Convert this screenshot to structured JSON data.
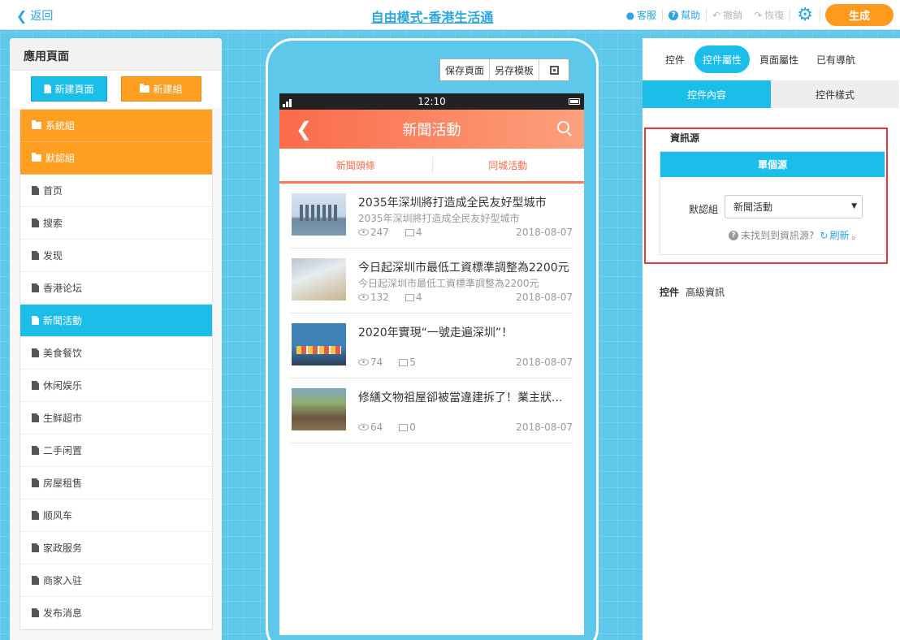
{
  "topbar": {
    "back_label": "返回",
    "title": "自由模式-香港生活通",
    "service_label": "客服",
    "help_label": "幫助",
    "undo_label": "撤銷",
    "redo_label": "恢復",
    "generate_label": "生成"
  },
  "left": {
    "title": "應用頁面",
    "new_page_label": "新建頁面",
    "new_group_label": "新建組",
    "groups": [
      {
        "label": "系統組"
      },
      {
        "label": "默認組"
      }
    ],
    "pages": [
      {
        "label": "首页"
      },
      {
        "label": "搜索"
      },
      {
        "label": "发现"
      },
      {
        "label": "香港论坛"
      },
      {
        "label": "新聞活動"
      },
      {
        "label": "美食餐饮"
      },
      {
        "label": "休闲娱乐"
      },
      {
        "label": "生鲜超市"
      },
      {
        "label": "二手闲置"
      },
      {
        "label": "房屋租售"
      },
      {
        "label": "顺风车"
      },
      {
        "label": "家政服务"
      },
      {
        "label": "商家入驻"
      },
      {
        "label": "发布消息"
      }
    ]
  },
  "phone": {
    "save_page_label": "保存頁面",
    "save_template_label": "另存模板",
    "time": "12:10",
    "nav_title": "新聞活動",
    "tabs": [
      "新聞頭條",
      "同城活動"
    ],
    "news": [
      {
        "title": "2035年深圳將打造成全民友好型城市",
        "sub": "2035年深圳將打造成全民友好型城市",
        "views": "247",
        "comments": "4",
        "date": "2018-08-07"
      },
      {
        "title": "今日起深圳市最低工資標準調整為2200元",
        "sub": "今日起深圳市最低工資標準調整為2200元",
        "views": "132",
        "comments": "4",
        "date": "2018-08-07"
      },
      {
        "title": "2020年實現“一號走遍深圳”！",
        "sub": "",
        "views": "74",
        "comments": "5",
        "date": "2018-08-07"
      },
      {
        "title": "修繕文物祖屋卻被當違建拆了！業主狀...",
        "sub": "",
        "views": "64",
        "comments": "0",
        "date": "2018-08-07"
      }
    ]
  },
  "right": {
    "tabs": [
      "控件",
      "控件屬性",
      "頁面屬性",
      "已有導航"
    ],
    "subtabs": [
      "控件內容",
      "控件樣式"
    ],
    "source_label": "資訊源",
    "single_source_label": "單個源",
    "default_group_label": "默認組",
    "default_group_value": "新聞活動",
    "hint_text": "未找到到資訊源?",
    "refresh_label": "刷新",
    "hint_tail": "。",
    "ctrl_label": "控件",
    "advanced_label": "高級資訊"
  },
  "colors": {
    "accent": "#1bbde9",
    "orange": "#ff9f22",
    "nav_gradient_start": "#fb6b4a",
    "highlight_border": "#e03c3c"
  }
}
